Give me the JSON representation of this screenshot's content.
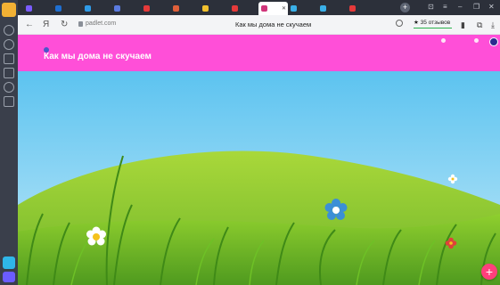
{
  "browser": {
    "tabs": [
      {
        "title": "",
        "favicon_color": "#7a5cff"
      },
      {
        "title": "",
        "favicon_color": "#1f6fd1"
      },
      {
        "title": "",
        "favicon_color": "#2f9be8"
      },
      {
        "title": "",
        "favicon_color": "#5b7be0"
      },
      {
        "title": "",
        "favicon_color": "#e63a3a"
      },
      {
        "title": "",
        "favicon_color": "#e0603a"
      },
      {
        "title": "",
        "favicon_color": "#f2c12e"
      },
      {
        "title": "",
        "favicon_color": "#e63a3a"
      },
      {
        "title": "",
        "favicon_color": "#d0357a",
        "active": true
      },
      {
        "title": "",
        "favicon_color": "#3ab0e8"
      },
      {
        "title": "",
        "favicon_color": "#3ab0e8"
      },
      {
        "title": "",
        "favicon_color": "#e63a3a"
      }
    ],
    "new_tab_label": "+",
    "close_glyph": "✕",
    "window_controls": [
      "⊡",
      "≡",
      "–",
      "❐",
      "✕"
    ],
    "nav": {
      "back": "←",
      "forward": "Я",
      "reload": "↻"
    },
    "url": "padlet.com",
    "page_title": "Как мы дома не скучаем",
    "reviews": "★ 35 отзывов",
    "icons": {
      "search": "search-icon",
      "bookmark": "bookmark-icon",
      "extension": "extension-icon",
      "download": "download-icon"
    }
  },
  "sidebar": {
    "logo_text": "",
    "icons": [
      "bell-icon",
      "clock-icon",
      "star-icon",
      "note-icon",
      "play-icon",
      "calendar-icon"
    ]
  },
  "padlet": {
    "logo": "",
    "author": "",
    "title": "Как мы дома не скучаем",
    "subtitle": "",
    "actions": [
      "",
      "",
      ""
    ],
    "accent_color": "#ff4fd8",
    "fab_label": "+"
  }
}
